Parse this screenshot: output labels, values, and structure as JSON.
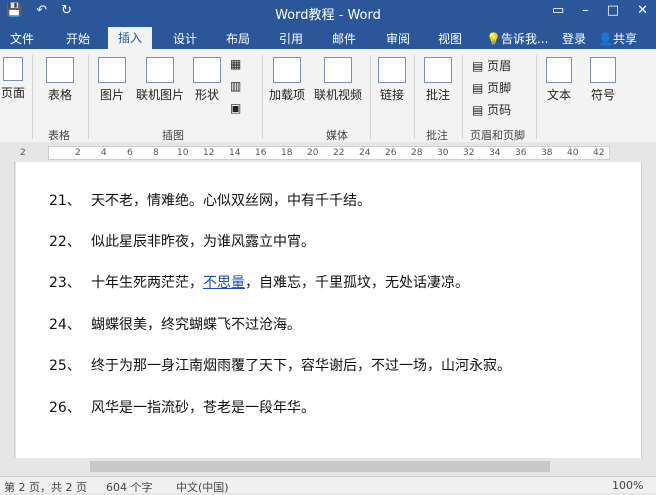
{
  "titlebar": {
    "title": "Word教程 - Word",
    "qat": {
      "save_icon": "💾",
      "undo_icon": "↶",
      "redo_icon": "↻"
    },
    "controls": {
      "restore": "▭",
      "minimize": "–",
      "maximize": "□",
      "close": "✕"
    }
  },
  "tabs": [
    "文件",
    "开始",
    "插入",
    "设计",
    "布局",
    "引用",
    "邮件",
    "审阅",
    "视图"
  ],
  "tell_me": "告诉我...",
  "login": "登录",
  "share": "共享",
  "ribbon": {
    "pages": "页面",
    "table": "表格",
    "picture": "图片",
    "online_picture": "联机图片",
    "shapes": "形状",
    "addins": "加载项",
    "online_video": "联机视频",
    "link": "链接",
    "comment": "批注",
    "header": "页眉",
    "footer": "页脚",
    "page_number": "页码",
    "text": "文本",
    "symbol": "符号",
    "groups": {
      "table": "表格",
      "illustrations": "插图",
      "media": "媒体",
      "comments": "批注",
      "header_footer": "页眉和页脚"
    }
  },
  "ruler": [
    "2",
    "2",
    "4",
    "6",
    "8",
    "10",
    "12",
    "14",
    "16",
    "18",
    "20",
    "22",
    "24",
    "26",
    "28",
    "30",
    "32",
    "34",
    "36",
    "38",
    "40",
    "42"
  ],
  "document": {
    "lines": [
      {
        "num": "21、",
        "text": "天不老，情难绝。心似双丝网，中有千千结。"
      },
      {
        "num": "22、",
        "text": "似此星辰非昨夜，为谁风露立中宵。"
      },
      {
        "num": "23、",
        "pre": "十年生死两茫茫，",
        "link": "不思量",
        "post": "，自难忘，千里孤坟，无处话凄凉。"
      },
      {
        "num": "24、",
        "text": "蝴蝶很美，终究蝴蝶飞不过沧海。"
      },
      {
        "num": "25、",
        "text": "终于为那一身江南烟雨覆了天下，容华谢后，不过一场，山河永寂。"
      },
      {
        "num": "26、",
        "text": "风华是一指流砂，苍老是一段年华。"
      }
    ]
  },
  "status": {
    "page": "第 2 页，共 2 页",
    "words": "604 个字",
    "language": "中文(中国)",
    "zoom": "100%"
  }
}
